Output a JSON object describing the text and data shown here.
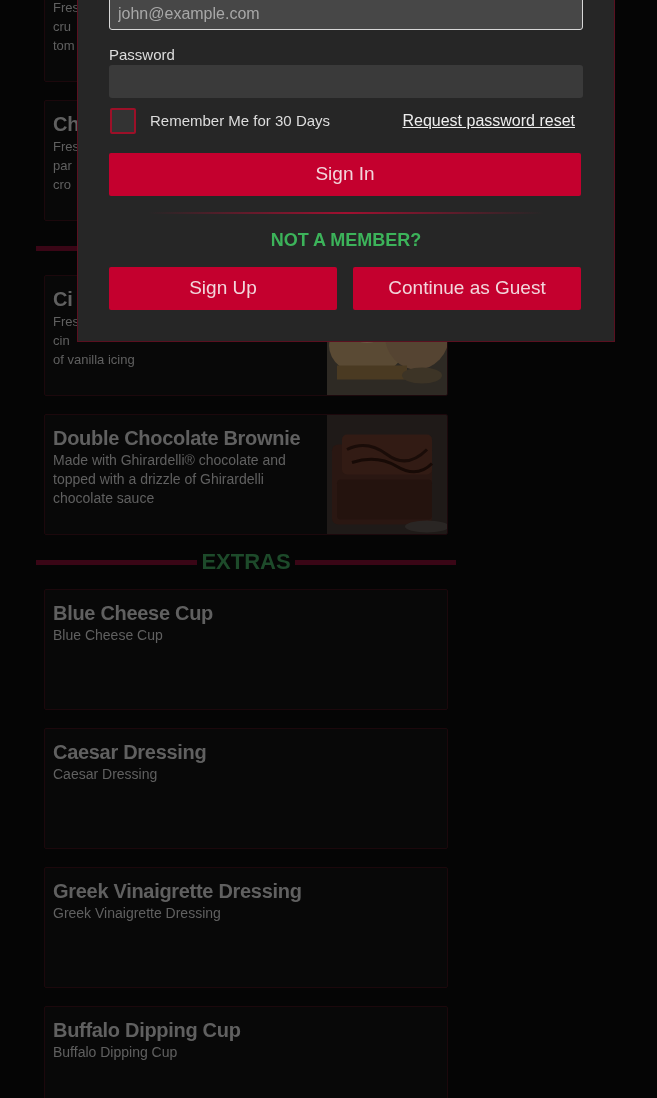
{
  "menu": {
    "sections": [
      {
        "divider": false,
        "items": [
          {
            "description": [
              "Fres",
              "cru",
              "tom"
            ]
          },
          {
            "title": "Ch",
            "description": [
              "Fres",
              "par",
              "cro"
            ]
          }
        ]
      },
      {
        "divider": true,
        "items": [
          {
            "title": "Ci",
            "description": [
              "Fres",
              "cin",
              "of vanilla icing"
            ],
            "photo": true
          },
          {
            "title": "Double Chocolate Brownie",
            "description": "Made with Ghirardelli® chocolate and topped with a drizzle of Ghirardelli chocolate sauce",
            "photo": true
          }
        ]
      },
      {
        "divider": true,
        "heading": "EXTRAS",
        "items": [
          {
            "title": "Blue Cheese Cup",
            "description": "Blue Cheese Cup"
          },
          {
            "title": "Caesar Dressing",
            "description": "Caesar Dressing"
          },
          {
            "title": "Greek Vinaigrette Dressing",
            "description": "Greek Vinaigrette Dressing"
          },
          {
            "title": "Buffalo Dipping Cup",
            "description": "Buffalo Dipping Cup"
          }
        ]
      }
    ]
  },
  "modal": {
    "email": {
      "placeholder": "john@example.com"
    },
    "password": {
      "label": "Password"
    },
    "remember": {
      "label": "Remember Me for 30 Days",
      "checked": false
    },
    "reset_link": "Request password reset",
    "sign_in": "Sign In",
    "not_member": "NOT A MEMBER?",
    "sign_up": "Sign Up",
    "guest": "Continue as Guest"
  }
}
